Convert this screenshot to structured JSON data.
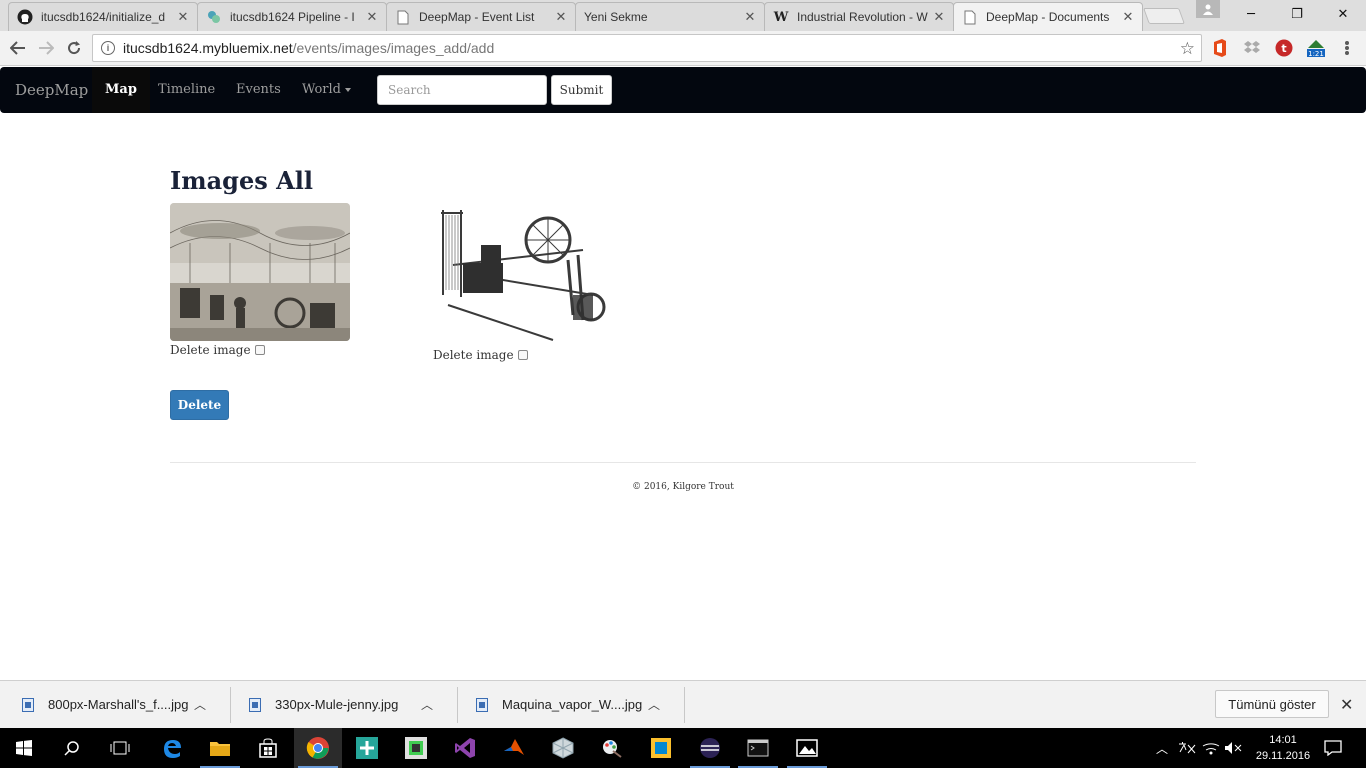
{
  "browser": {
    "tabs": [
      {
        "title": "itucsdb1624/initialize_d",
        "icon": "github-icon"
      },
      {
        "title": "itucsdb1624 Pipeline - I",
        "icon": "pipeline-icon"
      },
      {
        "title": "DeepMap - Event List",
        "icon": "page-icon"
      },
      {
        "title": "Yeni Sekme",
        "icon": "none"
      },
      {
        "title": "Industrial Revolution - W",
        "icon": "wikipedia-icon"
      },
      {
        "title": "DeepMap - Documents",
        "icon": "page-icon",
        "active": true
      }
    ],
    "url_host": "itucsdb1624.mybluemix.net",
    "url_path": "/events/images/images_add/add",
    "ext_badge": "1:21"
  },
  "navbar": {
    "brand": "DeepMap",
    "links": [
      "Map",
      "Timeline",
      "Events",
      "World"
    ],
    "active_link": "Map",
    "search_placeholder": "Search",
    "submit_label": "Submit"
  },
  "main": {
    "title": "Images All",
    "images": [
      {
        "alt": "Marshall's flax mill engraving",
        "delete_label": "Delete image",
        "checked": false
      },
      {
        "alt": "Mule jenny spinning machine",
        "delete_label": "Delete image",
        "checked": false
      }
    ],
    "delete_button": "Delete",
    "footer": "© 2016, Kilgore Trout"
  },
  "downloads": {
    "files": [
      "800px-Marshall's_f....jpg",
      "330px-Mule-jenny.jpg",
      "Maquina_vapor_W....jpg"
    ],
    "show_all": "Tümünü göster"
  },
  "taskbar": {
    "time": "14:01",
    "date": "29.11.2016"
  },
  "colors": {
    "navbar_bg": "#03070f",
    "primary_button": "#337ab7",
    "title_text": "#1a2238"
  }
}
